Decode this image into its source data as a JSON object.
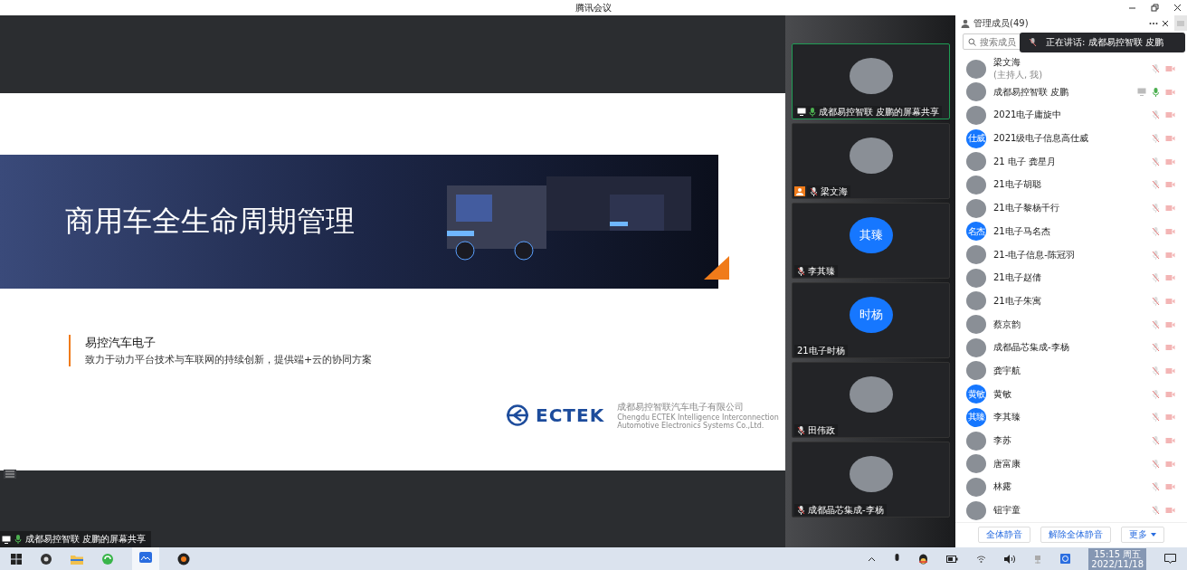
{
  "window": {
    "title": "腾讯会议"
  },
  "share": {
    "label": "成都易控智联 皮鹏的屏幕共享"
  },
  "slide": {
    "title": "商用车全生命周期管理",
    "company": "易控汽车电子",
    "tagline": "致力于动力平台技术与车联网的持续创新，提供端+云的协同方案",
    "logo": "ECTEK",
    "logo_cn": "成都易控智联汽车电子有限公司",
    "logo_en1": "Chengdu ECTEK Intelligence Interconnection",
    "logo_en2": "Automotive Electronics Systems Co.,Ltd."
  },
  "tiles": [
    {
      "name": "成都易控智联 皮鹏的屏幕共享",
      "avatar": {
        "kind": "photo"
      },
      "selected": true,
      "host": false,
      "muted": false,
      "sharing": true
    },
    {
      "name": "梁文海",
      "avatar": {
        "kind": "photo"
      },
      "selected": false,
      "host": true,
      "muted": true,
      "sharing": false
    },
    {
      "name": "李其臻",
      "avatar": {
        "kind": "initials",
        "text": "其臻"
      },
      "selected": false,
      "host": false,
      "muted": true,
      "sharing": false
    },
    {
      "name": "21电子时杨",
      "avatar": {
        "kind": "initials",
        "text": "时杨"
      },
      "selected": false,
      "host": false,
      "sharing": false
    },
    {
      "name": "田伟政",
      "avatar": {
        "kind": "photo"
      },
      "selected": false,
      "host": false,
      "muted": true,
      "sharing": false
    },
    {
      "name": "成都晶芯集成-李杨",
      "avatar": {
        "kind": "photo"
      },
      "selected": false,
      "host": false,
      "muted": true,
      "sharing": false
    }
  ],
  "members_panel": {
    "title": "管理成员(49)",
    "search_placeholder": "搜索成员",
    "speaking": "正在讲话: 成都易控智联 皮鹏",
    "members": [
      {
        "name": "梁文海",
        "note": "(主持人, 我)",
        "avatar": {
          "kind": "photo"
        },
        "muted": true,
        "sharing": false
      },
      {
        "name": "成都易控智联 皮鹏",
        "avatar": {
          "kind": "photo"
        },
        "muted": false,
        "sharing": true
      },
      {
        "name": "2021电子庸旋中",
        "avatar": {
          "kind": "photo"
        },
        "muted": true,
        "sharing": false
      },
      {
        "name": "2021级电子信息高仕威",
        "avatar": {
          "kind": "initials",
          "text": "仕威"
        },
        "muted": true,
        "sharing": false
      },
      {
        "name": "21 电子 龚星月",
        "avatar": {
          "kind": "photo"
        },
        "muted": true,
        "sharing": false
      },
      {
        "name": "21电子胡聪",
        "avatar": {
          "kind": "photo"
        },
        "muted": true,
        "sharing": false
      },
      {
        "name": "21电子黎杨千行",
        "avatar": {
          "kind": "photo"
        },
        "muted": true,
        "sharing": false
      },
      {
        "name": "21电子马名杰",
        "avatar": {
          "kind": "initials",
          "text": "名杰"
        },
        "muted": true,
        "sharing": false
      },
      {
        "name": "21-电子信息-陈冠羽",
        "avatar": {
          "kind": "photo"
        },
        "muted": true,
        "sharing": false
      },
      {
        "name": "21电子赵倩",
        "avatar": {
          "kind": "photo"
        },
        "muted": true,
        "sharing": false
      },
      {
        "name": "21电子朱寓",
        "avatar": {
          "kind": "photo"
        },
        "muted": true,
        "sharing": false
      },
      {
        "name": "蔡京韵",
        "avatar": {
          "kind": "photo"
        },
        "muted": true,
        "sharing": false
      },
      {
        "name": "成都晶芯集成-李杨",
        "avatar": {
          "kind": "photo"
        },
        "muted": true,
        "sharing": false
      },
      {
        "name": "龚宇航",
        "avatar": {
          "kind": "photo"
        },
        "muted": true,
        "sharing": false
      },
      {
        "name": "黄敏",
        "avatar": {
          "kind": "initials",
          "text": "黄敏"
        },
        "muted": true,
        "sharing": false
      },
      {
        "name": "李其臻",
        "avatar": {
          "kind": "initials",
          "text": "其臻"
        },
        "muted": true,
        "sharing": false
      },
      {
        "name": "李苏",
        "avatar": {
          "kind": "photo"
        },
        "muted": true,
        "sharing": false
      },
      {
        "name": "唐富康",
        "avatar": {
          "kind": "photo"
        },
        "muted": true,
        "sharing": false
      },
      {
        "name": "林露",
        "avatar": {
          "kind": "photo"
        },
        "muted": true,
        "sharing": false
      },
      {
        "name": "钮宇童",
        "avatar": {
          "kind": "photo"
        },
        "muted": true,
        "sharing": false
      }
    ],
    "buttons": [
      "全体静音",
      "解除全体静音",
      "更多"
    ]
  },
  "taskbar": {
    "time": "15:15 周五",
    "date": "2022/11/18"
  }
}
